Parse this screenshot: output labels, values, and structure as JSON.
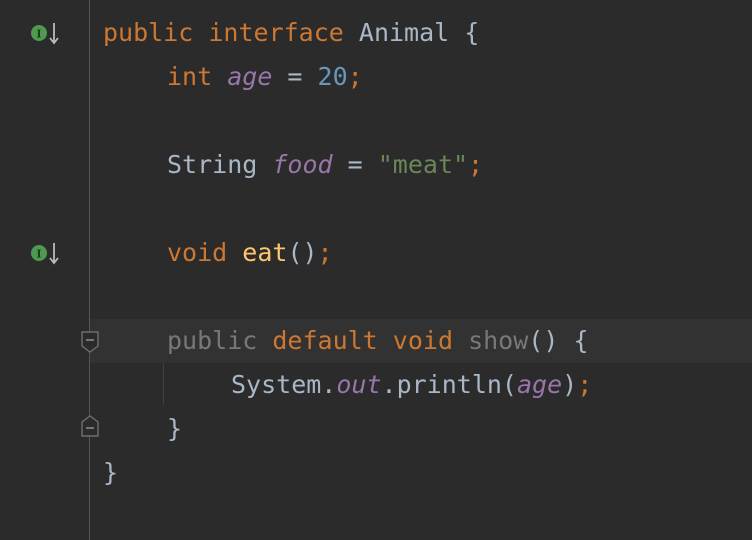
{
  "editor": {
    "lines": [
      {
        "tokens": [
          {
            "text": "public",
            "cls": "kw"
          },
          {
            "text": " ",
            "cls": "plain"
          },
          {
            "text": "interface",
            "cls": "kw"
          },
          {
            "text": " Animal {",
            "cls": "plain"
          }
        ]
      },
      {
        "tokens": [
          {
            "text": "int",
            "cls": "kw"
          },
          {
            "text": " ",
            "cls": "plain"
          },
          {
            "text": "age",
            "cls": "fld"
          },
          {
            "text": " = ",
            "cls": "plain"
          },
          {
            "text": "20",
            "cls": "num"
          },
          {
            "text": ";",
            "cls": "kw"
          }
        ]
      },
      {
        "tokens": [
          {
            "text": "String ",
            "cls": "plain"
          },
          {
            "text": "food",
            "cls": "fld"
          },
          {
            "text": " = ",
            "cls": "plain"
          },
          {
            "text": "\"meat\"",
            "cls": "str"
          },
          {
            "text": ";",
            "cls": "kw"
          }
        ]
      },
      {
        "tokens": [
          {
            "text": "void",
            "cls": "kw"
          },
          {
            "text": " ",
            "cls": "plain"
          },
          {
            "text": "eat",
            "cls": "mth"
          },
          {
            "text": "()",
            "cls": "plain"
          },
          {
            "text": ";",
            "cls": "kw"
          }
        ]
      },
      {
        "tokens": [
          {
            "text": "public",
            "cls": "unused"
          },
          {
            "text": " ",
            "cls": "plain"
          },
          {
            "text": "default",
            "cls": "kw"
          },
          {
            "text": " ",
            "cls": "plain"
          },
          {
            "text": "void",
            "cls": "kw"
          },
          {
            "text": " ",
            "cls": "plain"
          },
          {
            "text": "show",
            "cls": "unused"
          },
          {
            "text": "() {",
            "cls": "plain"
          }
        ]
      },
      {
        "tokens": [
          {
            "text": "System.",
            "cls": "plain"
          },
          {
            "text": "out",
            "cls": "fld"
          },
          {
            "text": ".println(",
            "cls": "plain"
          },
          {
            "text": "age",
            "cls": "fld"
          },
          {
            "text": ")",
            "cls": "plain"
          },
          {
            "text": ";",
            "cls": "kw"
          }
        ]
      },
      {
        "tokens": [
          {
            "text": "}",
            "cls": "plain"
          }
        ]
      },
      {
        "tokens": [
          {
            "text": "}",
            "cls": "plain"
          }
        ]
      }
    ]
  },
  "gutter": {
    "impl_icon_label": "I",
    "impl_icon_color": "#4e9a4e",
    "fold_icon_color": "#6e6e6e"
  },
  "colors": {
    "background": "#2b2b2b",
    "current_line": "#323232",
    "keyword": "#cc7832",
    "field": "#9876aa",
    "number": "#6897bb",
    "string": "#6a8759",
    "method": "#ffc66d",
    "plain": "#a9b7c6",
    "unused": "#787878"
  }
}
